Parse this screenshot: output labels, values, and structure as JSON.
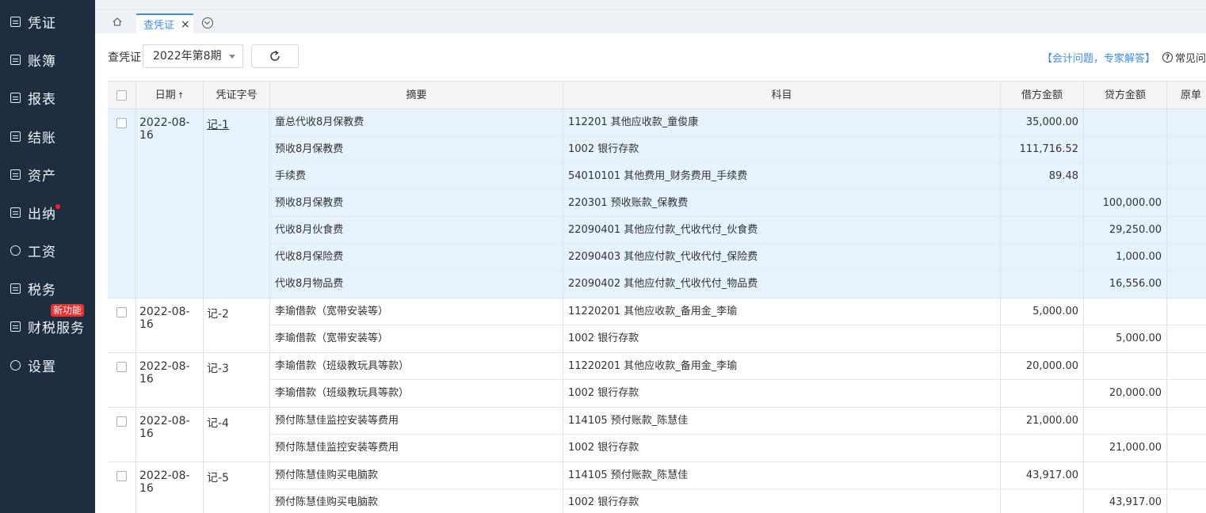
{
  "sidebar": {
    "items": [
      {
        "label": "凭证",
        "icon": "voucher-icon"
      },
      {
        "label": "账簿",
        "icon": "ledger-icon"
      },
      {
        "label": "报表",
        "icon": "report-icon"
      },
      {
        "label": "结账",
        "icon": "closing-icon"
      },
      {
        "label": "资产",
        "icon": "asset-icon"
      },
      {
        "label": "出纳",
        "icon": "cashier-icon"
      },
      {
        "label": "工资",
        "icon": "salary-icon"
      },
      {
        "label": "税务",
        "icon": "tax-icon"
      },
      {
        "label": "财税服务",
        "icon": "finance-service-icon"
      },
      {
        "label": "设置",
        "icon": "settings-icon"
      }
    ],
    "new_badge": "新功能"
  },
  "tabs": {
    "active_label": "查凭证",
    "close_symbol": "×"
  },
  "toolbar": {
    "label": "查凭证",
    "period_value": "2022年第8期",
    "expert_link": "【会计问题，专家解答】",
    "faq_label": "常见问",
    "faq_icon_glyph": "?"
  },
  "table": {
    "columns": {
      "date": "日期",
      "voucher_no": "凭证字号",
      "summary": "摘要",
      "account": "科目",
      "debit": "借方金额",
      "credit": "贷方金额",
      "original": "原单"
    },
    "sort_glyph": "↑",
    "vouchers": [
      {
        "date": "2022-08-16",
        "no": "记-1",
        "selected": true,
        "entries": [
          {
            "summary": "童总代收8月保教费",
            "account": "112201 其他应收款_童俊康",
            "debit": "35,000.00",
            "credit": ""
          },
          {
            "summary": "预收8月保教费",
            "account": "1002 银行存款",
            "debit": "111,716.52",
            "credit": ""
          },
          {
            "summary": "手续费",
            "account": "54010101 其他费用_财务费用_手续费",
            "debit": "89.48",
            "credit": ""
          },
          {
            "summary": "预收8月保教费",
            "account": "220301 预收账款_保教费",
            "debit": "",
            "credit": "100,000.00"
          },
          {
            "summary": "代收8月伙食费",
            "account": "22090401 其他应付款_代收代付_伙食费",
            "debit": "",
            "credit": "29,250.00"
          },
          {
            "summary": "代收8月保险费",
            "account": "22090403 其他应付款_代收代付_保险费",
            "debit": "",
            "credit": "1,000.00"
          },
          {
            "summary": "代收8月物品费",
            "account": "22090402 其他应付款_代收代付_物品费",
            "debit": "",
            "credit": "16,556.00"
          }
        ]
      },
      {
        "date": "2022-08-16",
        "no": "记-2",
        "selected": false,
        "entries": [
          {
            "summary": "李瑜借款（宽带安装等）",
            "account": "11220201 其他应收款_备用金_李瑜",
            "debit": "5,000.00",
            "credit": ""
          },
          {
            "summary": "李瑜借款（宽带安装等）",
            "account": "1002 银行存款",
            "debit": "",
            "credit": "5,000.00"
          }
        ]
      },
      {
        "date": "2022-08-16",
        "no": "记-3",
        "selected": false,
        "entries": [
          {
            "summary": "李瑜借款（班级教玩具等款）",
            "account": "11220201 其他应收款_备用金_李瑜",
            "debit": "20,000.00",
            "credit": ""
          },
          {
            "summary": "李瑜借款（班级教玩具等款）",
            "account": "1002 银行存款",
            "debit": "",
            "credit": "20,000.00"
          }
        ]
      },
      {
        "date": "2022-08-16",
        "no": "记-4",
        "selected": false,
        "entries": [
          {
            "summary": "预付陈慧佳监控安装等费用",
            "account": "114105 预付账款_陈慧佳",
            "debit": "21,000.00",
            "credit": ""
          },
          {
            "summary": "预付陈慧佳监控安装等费用",
            "account": "1002 银行存款",
            "debit": "",
            "credit": "21,000.00"
          }
        ]
      },
      {
        "date": "2022-08-16",
        "no": "记-5",
        "selected": false,
        "entries": [
          {
            "summary": "预付陈慧佳购买电脑款",
            "account": "114105 预付账款_陈慧佳",
            "debit": "43,917.00",
            "credit": ""
          },
          {
            "summary": "预付陈慧佳购买电脑款",
            "account": "1002 银行存款",
            "debit": "",
            "credit": "43,917.00"
          }
        ]
      }
    ]
  }
}
